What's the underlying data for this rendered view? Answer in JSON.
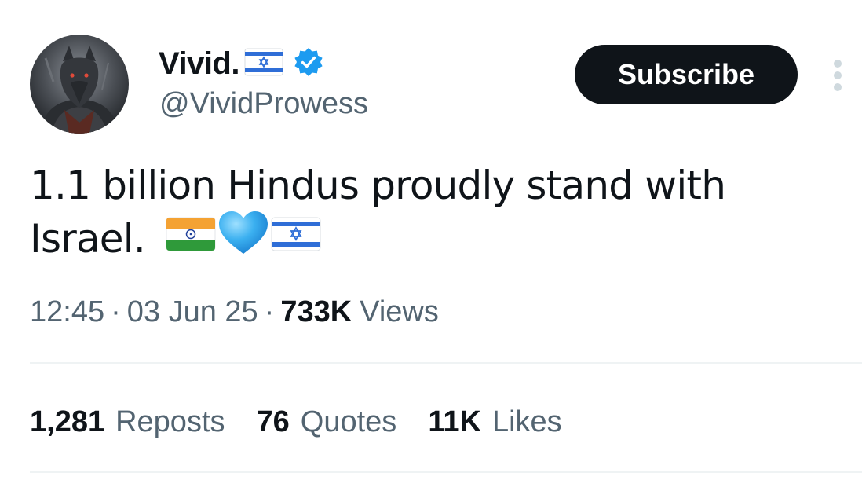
{
  "tweet": {
    "author": {
      "display_name": "Vivid.",
      "handle": "@VividProwess",
      "avatar_icon": "wolf-warrior-avatar",
      "verified": true,
      "verified_color": "#1d9bf0"
    },
    "subscribe_label": "Subscribe",
    "text_line1": "1.1 billion Hindus proudly stand with",
    "text_line2": "Israel.",
    "emojis": [
      "india-flag-icon",
      "blue-heart-icon",
      "israel-flag-icon"
    ],
    "time": "12:45",
    "date": "03 Jun 25",
    "separator": "·",
    "views_count": "733K",
    "views_label": "Views",
    "stats": [
      {
        "count": "1,281",
        "label": "Reposts"
      },
      {
        "count": "76",
        "label": "Quotes"
      },
      {
        "count": "11K",
        "label": "Likes"
      }
    ]
  },
  "colors": {
    "text_primary": "#0f1419",
    "text_secondary": "#536471",
    "button_bg": "#0f1419",
    "divider": "#eff3f4"
  }
}
